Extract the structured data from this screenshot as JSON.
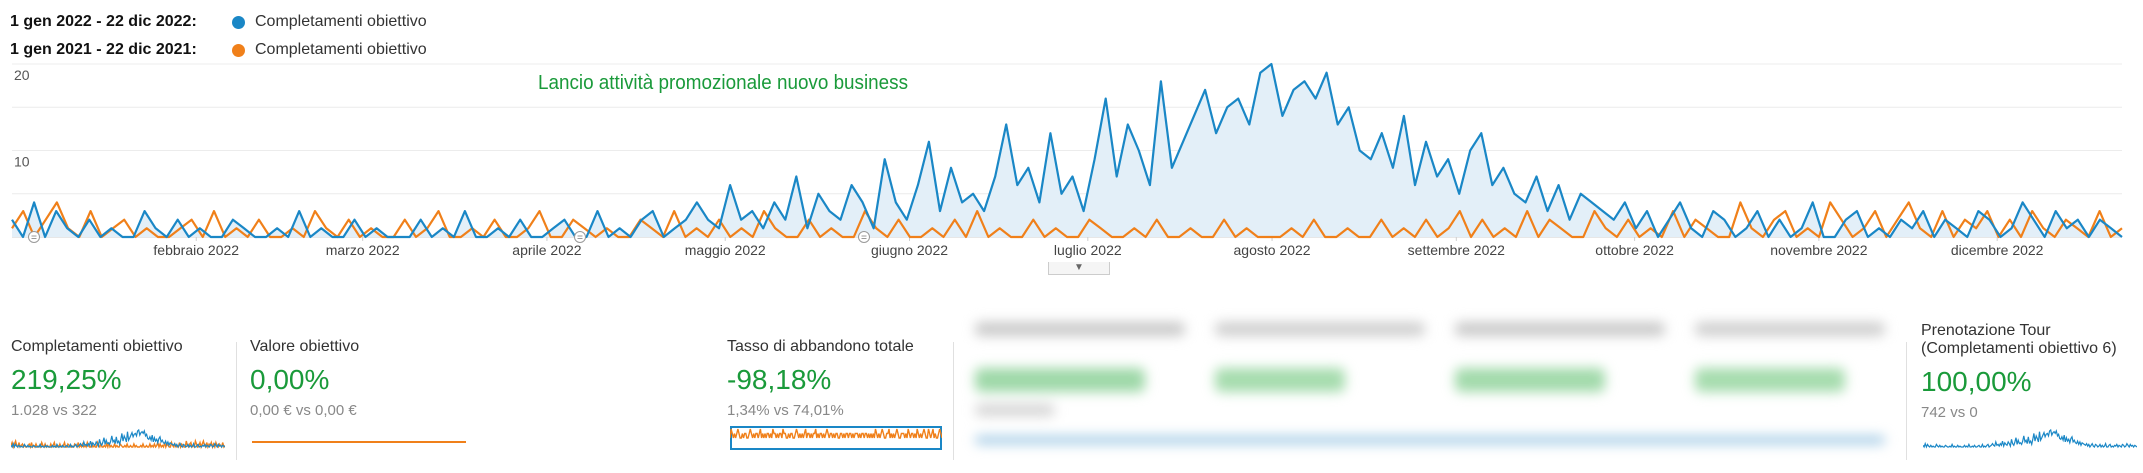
{
  "legend": [
    {
      "range": "1 gen 2022 - 22 dic 2022:",
      "series": "Completamenti obiettivo",
      "color": "#1a87c6"
    },
    {
      "range": "1 gen 2021 - 22 dic 2021:",
      "series": "Completamenti obiettivo",
      "color": "#f0801a"
    }
  ],
  "chart_data": {
    "type": "line",
    "title": "",
    "annotation": "Lancio attività promozionale nuovo business",
    "annotation_color": "#1a9a3a",
    "x_tick_labels": [
      "febbraio 2022",
      "marzo 2022",
      "aprile 2022",
      "maggio 2022",
      "giugno 2022",
      "luglio 2022",
      "agosto 2022",
      "settembre 2022",
      "ottobre 2022",
      "novembre 2022",
      "dicembre 2022"
    ],
    "y_tick_labels": [
      "20",
      "10"
    ],
    "ylim": [
      0,
      20
    ],
    "x_range": [
      "2022-01-01",
      "2022-12-22"
    ],
    "grid": true,
    "series": [
      {
        "color": "#1a87c6",
        "fill": "#e3eff8",
        "values": [
          2,
          0,
          4,
          0,
          3,
          1,
          0,
          2,
          0,
          1,
          0,
          0,
          3,
          1,
          0,
          2,
          0,
          1,
          0,
          0,
          2,
          1,
          0,
          0,
          1,
          0,
          3,
          0,
          1,
          0,
          0,
          2,
          0,
          1,
          0,
          0,
          0,
          2,
          0,
          1,
          0,
          3,
          0,
          0,
          1,
          0,
          2,
          0,
          0,
          1,
          2,
          0,
          0,
          3,
          0,
          1,
          0,
          2,
          3,
          0,
          1,
          2,
          4,
          2,
          1,
          6,
          2,
          3,
          1,
          4,
          2,
          7,
          1,
          5,
          3,
          2,
          6,
          4,
          1,
          9,
          4,
          2,
          6,
          11,
          3,
          8,
          4,
          5,
          3,
          7,
          13,
          6,
          8,
          4,
          12,
          5,
          7,
          3,
          9,
          16,
          7,
          13,
          10,
          6,
          18,
          8,
          11,
          14,
          17,
          12,
          15,
          16,
          13,
          19,
          20,
          14,
          17,
          18,
          16,
          19,
          13,
          15,
          10,
          9,
          12,
          8,
          14,
          6,
          11,
          7,
          9,
          5,
          10,
          12,
          6,
          8,
          5,
          4,
          7,
          3,
          6,
          2,
          5,
          4,
          3,
          2,
          4,
          1,
          3,
          0,
          2,
          4,
          1,
          0,
          3,
          2,
          0,
          1,
          3,
          0,
          2,
          0,
          1,
          4,
          0,
          0,
          2,
          3,
          0,
          1,
          0,
          2,
          1,
          3,
          0,
          2,
          1,
          0,
          3,
          2,
          0,
          1,
          4,
          2,
          0,
          3,
          1,
          2,
          0,
          2,
          1,
          0
        ]
      },
      {
        "color": "#f0801a",
        "values": [
          1,
          3,
          0,
          2,
          4,
          1,
          0,
          3,
          0,
          1,
          2,
          0,
          1,
          0,
          0,
          1,
          2,
          0,
          3,
          0,
          1,
          0,
          2,
          0,
          0,
          1,
          0,
          3,
          1,
          0,
          2,
          0,
          1,
          0,
          0,
          2,
          0,
          1,
          3,
          0,
          0,
          1,
          0,
          2,
          0,
          0,
          1,
          3,
          0,
          0,
          2,
          1,
          0,
          1,
          0,
          0,
          2,
          1,
          0,
          3,
          0,
          1,
          0,
          2,
          0,
          1,
          0,
          3,
          1,
          0,
          0,
          2,
          0,
          1,
          0,
          0,
          3,
          1,
          0,
          2,
          0,
          0,
          1,
          0,
          2,
          0,
          3,
          0,
          1,
          0,
          0,
          2,
          0,
          1,
          0,
          0,
          2,
          1,
          0,
          0,
          1,
          0,
          2,
          0,
          0,
          1,
          0,
          0,
          2,
          0,
          1,
          0,
          0,
          0,
          1,
          0,
          2,
          0,
          0,
          1,
          0,
          0,
          2,
          0,
          1,
          0,
          2,
          0,
          1,
          3,
          0,
          2,
          0,
          1,
          0,
          3,
          0,
          2,
          1,
          0,
          0,
          3,
          1,
          0,
          2,
          0,
          1,
          0,
          3,
          0,
          2,
          1,
          0,
          0,
          4,
          1,
          0,
          2,
          3,
          0,
          1,
          0,
          4,
          2,
          0,
          1,
          3,
          0,
          2,
          4,
          1,
          0,
          3,
          0,
          2,
          1,
          3,
          0,
          2,
          0,
          3,
          1,
          0,
          2,
          1,
          0,
          3,
          0,
          1
        ]
      }
    ]
  },
  "metrics": [
    {
      "title": "Completamenti obiettivo",
      "value": "219,25%",
      "compare": "1.028 vs 322"
    },
    {
      "title": "Valore obiettivo",
      "value": "0,00%",
      "compare": "0,00 € vs 0,00 €"
    },
    {
      "title": "Tasso di abbandono totale",
      "value": "-98,18%",
      "compare": "1,34% vs 74,01%"
    },
    {
      "title_line1": "Prenotazione Tour",
      "title_line2": "(Completamenti obiettivo 6)",
      "value": "100,00%",
      "compare": "742 vs 0"
    }
  ]
}
